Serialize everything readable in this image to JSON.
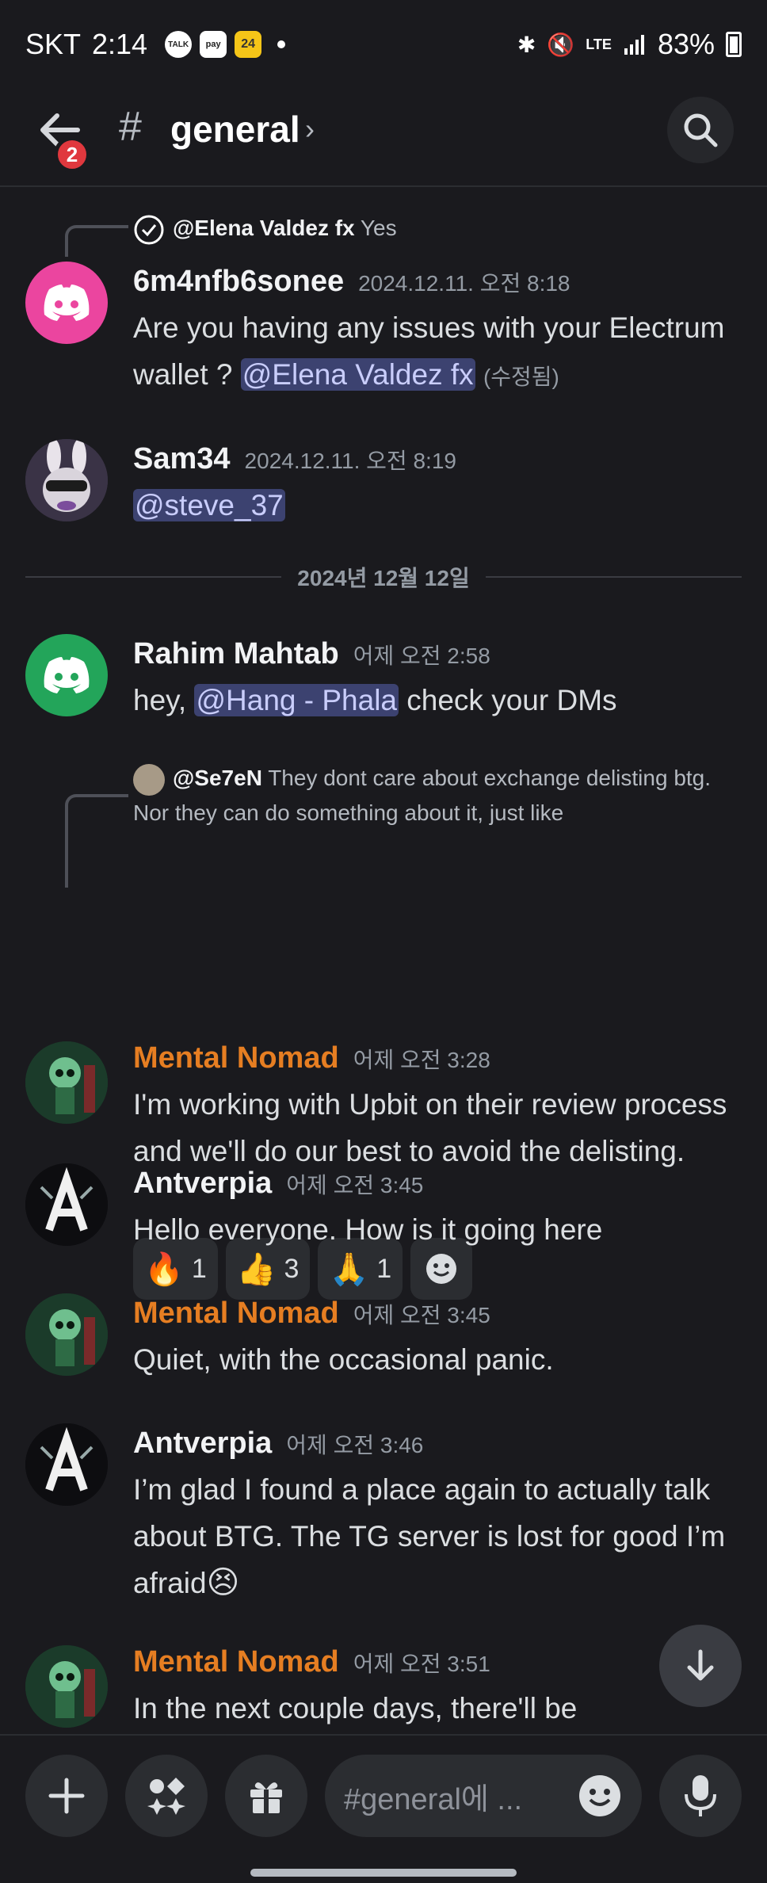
{
  "status_bar": {
    "carrier": "SKT",
    "time": "2:14",
    "noti_icons": [
      "TALK",
      "pay",
      "24"
    ],
    "network": "LTE",
    "battery": "83%"
  },
  "header": {
    "channel_name": "general",
    "unread_badge": "2"
  },
  "messages": [
    {
      "reply": {
        "name": "@Elena Valdez fx",
        "text": "Yes"
      },
      "author": "6m4nfb6sonee",
      "time": "2024.12.11. 오전 8:18",
      "text_a": "Are you having any issues with your Electrum wallet ? ",
      "mention": "@Elena Valdez fx",
      "edited": "(수정됨)"
    },
    {
      "author": "Sam34",
      "time": "2024.12.11. 오전 8:19",
      "mention": "@steve_37"
    },
    {
      "author": "Rahim Mahtab",
      "time": "어제 오전 2:58",
      "text_a": "hey, ",
      "mention": "@Hang - Phala",
      "text_b": " check your DMs"
    },
    {
      "reply": {
        "name": "@Se7eN",
        "text": "They dont care about exchange delisting btg. Nor they can do something about it, just like"
      },
      "author": "Mental Nomad",
      "time": "어제 오전 3:28",
      "text": "I'm working with Upbit on their review process and we'll do our best to avoid the delisting.",
      "reactions": [
        {
          "emoji": "🔥",
          "count": "1"
        },
        {
          "emoji": "👍",
          "count": "3"
        },
        {
          "emoji": "🙏",
          "count": "1"
        }
      ]
    },
    {
      "author": "Antverpia",
      "time": "어제 오전 3:45",
      "text": "Hello everyone. How is it going here"
    },
    {
      "author": "Mental Nomad",
      "time": "어제 오전 3:45",
      "text": "Quiet, with the occasional panic."
    },
    {
      "author": "Antverpia",
      "time": "어제 오전 3:46",
      "text": "I’m glad I found a place again to actually talk about BTG. The TG server is lost for good I’m afraid",
      "emoji": "😣"
    },
    {
      "author": "Mental Nomad",
      "time": "어제 오전 3:51",
      "text": "In the next couple days, there'll be"
    }
  ],
  "date_divider": "2024년 12월 12일",
  "composer": {
    "placeholder": "#general에 ..."
  },
  "colors": {
    "background": "#1a1a1e",
    "mention_bg": "#3c4270",
    "orange_name": "#e67e22",
    "badge_red": "#e0383e"
  }
}
